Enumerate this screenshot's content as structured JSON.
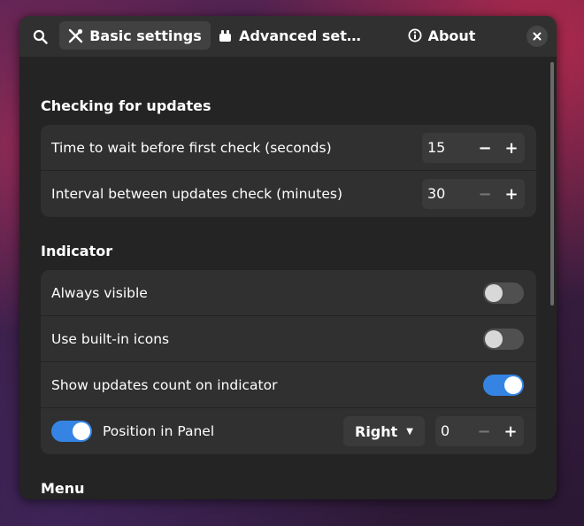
{
  "header": {
    "tabs": [
      {
        "icon": "tools-icon",
        "label": "Basic settings"
      },
      {
        "icon": "advanced-icon",
        "label": "Advanced set…"
      },
      {
        "icon": "info-icon",
        "label": "About"
      }
    ]
  },
  "sections": {
    "updates": {
      "title": "Checking for updates",
      "rows": [
        {
          "label": "Time to wait before first check (seconds)",
          "value": "15"
        },
        {
          "label": "Interval between updates check (minutes)",
          "value": "30"
        }
      ]
    },
    "indicator": {
      "title": "Indicator",
      "rows": [
        {
          "label": "Always visible",
          "toggle": false
        },
        {
          "label": "Use built-in icons",
          "toggle": false
        },
        {
          "label": "Show updates count on indicator",
          "toggle": true
        },
        {
          "label": "Position in Panel",
          "toggle": true,
          "dropdown": "Right",
          "value": "0"
        }
      ]
    },
    "menu": {
      "title": "Menu"
    }
  },
  "colors": {
    "accent": "#3584e4",
    "window_bg": "#242424",
    "card_bg": "#303030"
  }
}
